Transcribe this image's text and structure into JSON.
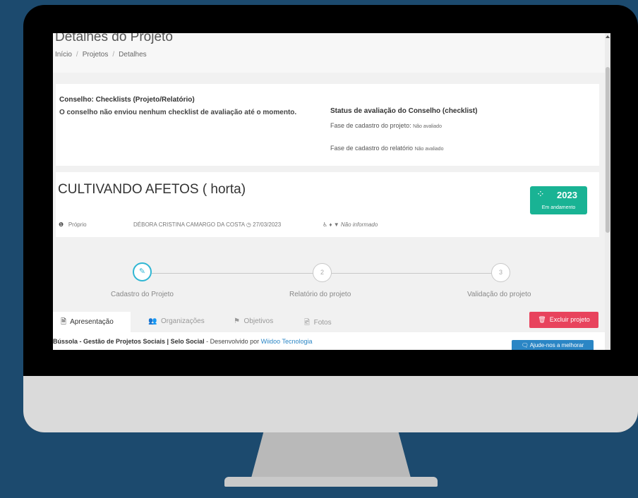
{
  "header": {
    "page_title": "Detalhes do Projeto",
    "breadcrumb": [
      "Início",
      "Projetos",
      "Detalhes"
    ]
  },
  "council": {
    "title": "Conselho: Checklists (Projeto/Relatório)",
    "message": "O conselho não enviou nenhum checklist de avaliação até o momento.",
    "status_title": "Status de avaliação do Conselho (checklist)",
    "project_phase_label": "Fase de cadastro do projeto:",
    "project_phase_value": "Não avaliado",
    "report_phase_label": "Fase de cadastro do relatório",
    "report_phase_value": "Não avaliado"
  },
  "project": {
    "title": "CULTIVANDO AFETOS ( horta)",
    "type": "Próprio",
    "author": "DÉBORA CRISTINA CAMARGO DA COSTA",
    "date": "27/03/2023",
    "accessibility": "Não informado",
    "year": "2023",
    "status": "Em andamento",
    "status_color": "#19b394"
  },
  "steps": [
    {
      "number": "✎",
      "label": "Cadastro do Projeto",
      "active": true
    },
    {
      "number": "2",
      "label": "Relatório do projeto",
      "active": false
    },
    {
      "number": "3",
      "label": "Validação do projeto",
      "active": false
    }
  ],
  "tabs": [
    {
      "label": "Apresentação",
      "icon": "document-icon"
    },
    {
      "label": "Organizações",
      "icon": "users-icon"
    },
    {
      "label": "Objetivos",
      "icon": "flag-icon"
    },
    {
      "label": "Fotos",
      "icon": "image-icon"
    }
  ],
  "actions": {
    "delete_label": "Excluir projeto",
    "delete_color": "#e8435d"
  },
  "footer": {
    "brand": "Bússola - Gestão de Projetos Sociais | Selo Social",
    "developed_by": "- Desenvolvido por",
    "developer": "Wiidoo Tecnologia",
    "help_label": "Ajude-nos a melhorar"
  }
}
